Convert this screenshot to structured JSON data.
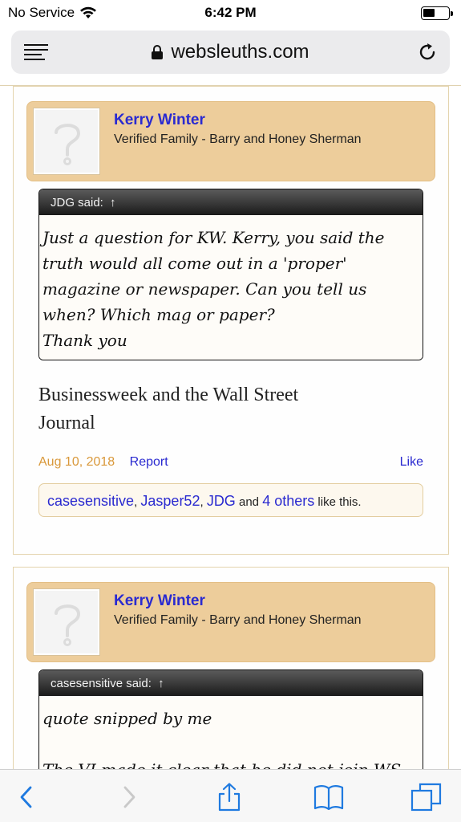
{
  "status_bar": {
    "carrier": "No Service",
    "time": "6:42 PM",
    "wifi_icon": "wifi-icon",
    "battery_icon": "battery-icon"
  },
  "browser": {
    "url": "websleuths.com",
    "menu_icon": "menu-icon",
    "lock_icon": "lock-icon",
    "reload_icon": "reload-icon"
  },
  "posts": [
    {
      "author": "Kerry Winter",
      "author_title": "Verified Family - Barry and Honey Sherman",
      "quote_header": "JDG said:",
      "quote_arrow": "↑",
      "quote_lines": [
        "Just a question for KW. Kerry, you said the",
        "truth would all come out in a 'proper'",
        "magazine or newspaper. Can you tell us",
        "when? Which mag or paper?",
        "Thank you"
      ],
      "message_lines": [
        "Businessweek and the Wall Street",
        "Journal"
      ],
      "date": "Aug 10, 2018",
      "report_label": "Report",
      "like_label": "Like",
      "likes": {
        "users": [
          "casesensitive",
          "Jasper52",
          "JDG"
        ],
        "sep1": ",",
        "sep2": ",",
        "and_text": "and",
        "others": "4 others",
        "tail": "like this."
      }
    },
    {
      "author": "Kerry Winter",
      "author_title": "Verified Family - Barry and Honey Sherman",
      "quote_header": "casesensitive said:",
      "quote_arrow": "↑",
      "quote_lines": [
        "quote snipped by me",
        "",
        "The VI made it clear that he did not join WS to"
      ]
    }
  ],
  "toolbar": {
    "back_icon": "back-icon",
    "forward_icon": "forward-icon",
    "share_icon": "share-icon",
    "bookmarks_icon": "bookmarks-icon",
    "tabs_icon": "tabs-icon"
  },
  "colors": {
    "link": "#2a2ad0",
    "date": "#d9983a",
    "userbar": "#edcd9b",
    "post_border": "#e4d4ae"
  }
}
